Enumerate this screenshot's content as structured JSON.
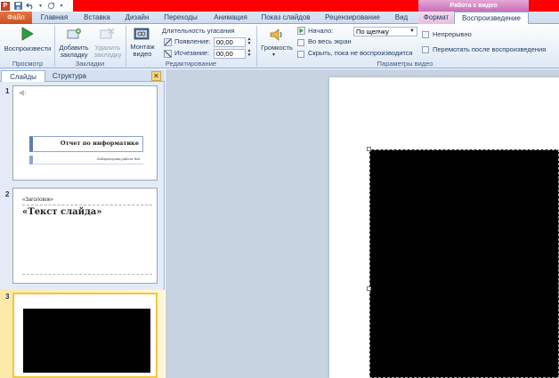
{
  "titlebar": {
    "context_header": "Работа с видео",
    "qat": {
      "app_icon": "P",
      "save_icon": "save-icon",
      "undo_icon": "undo-icon",
      "redo_icon": "redo-icon",
      "customize_icon": "dropdown-icon"
    }
  },
  "tabs": {
    "file": "Файл",
    "home": "Главная",
    "insert": "Вставка",
    "design": "Дизайн",
    "transitions": "Переходы",
    "animations": "Анимация",
    "slideshow": "Показ слайдов",
    "review": "Рецензирование",
    "view": "Вид",
    "format": "Формат",
    "playback": "Воспроизведение"
  },
  "ribbon": {
    "preview": {
      "play_label": "Воспроизвести",
      "group": "Просмотр"
    },
    "bookmarks": {
      "add_label": "Добавить закладку",
      "remove_label": "Удалить закладку",
      "group": "Закладки"
    },
    "editing": {
      "trim_label": "Монтаж видео",
      "fade_title": "Длительность угасания",
      "fade_in_label": "Появление:",
      "fade_in_value": "00,00",
      "fade_out_label": "Исчезание:",
      "fade_out_value": "00,00",
      "group": "Редактирование"
    },
    "video_options": {
      "volume_label": "Громкость",
      "start_label": "Начало:",
      "start_value": "По щелчку",
      "fullscreen_label": "Во весь экран",
      "hide_label": "Скрыть, пока не воспроизводится",
      "loop_label": "Непрерывно",
      "rewind_label": "Перемотать после воспроизведения",
      "group": "Параметры видео"
    }
  },
  "pane": {
    "tab_slides": "Слайды",
    "tab_outline": "Структура",
    "close": "✕",
    "slides": [
      {
        "num": "1",
        "title": "Отчет по информатике",
        "subtitle": "Лабораторная работа №5"
      },
      {
        "num": "2",
        "header": "«Заголовок»",
        "text": "«Текст слайда»"
      },
      {
        "num": "3"
      }
    ]
  },
  "colors": {
    "accent_red": "#ff0000",
    "file_tab": "#d2571f",
    "ribbon_bg": "#dde8f5"
  }
}
